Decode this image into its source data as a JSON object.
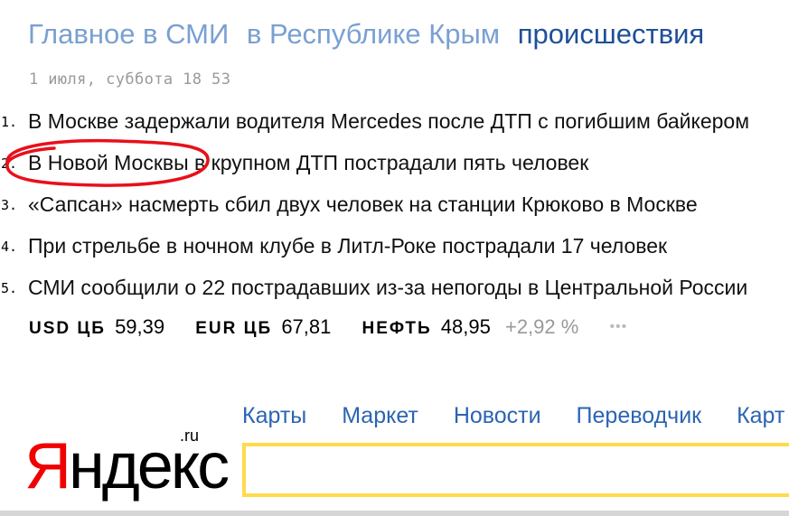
{
  "header": {
    "tabs": [
      {
        "label": "Главное в СМИ",
        "active": false
      },
      {
        "label": "в Республике Крым",
        "active": false
      },
      {
        "label": "происшествия",
        "active": true
      }
    ],
    "date": "1 июля, суббота 18 53"
  },
  "news": [
    {
      "num": "1.",
      "title": "В Москве задержали водителя Mercedes после ДТП с погибшим байкером"
    },
    {
      "num": "2.",
      "title": "В Новой Москвы в крупном ДТП пострадали пять человек"
    },
    {
      "num": "3.",
      "title": "«Сапсан» насмерть сбил двух человек на станции Крюково в Москве"
    },
    {
      "num": "4.",
      "title": "При стрельбе в ночном клубе в Литл-Роке пострадали 17 человек"
    },
    {
      "num": "5.",
      "title": "СМИ сообщили о 22 пострадавших из-за непогоды в Центральной России"
    }
  ],
  "stocks": {
    "usd": {
      "label": "USD ЦБ",
      "value": "59,39"
    },
    "eur": {
      "label": "EUR ЦБ",
      "value": "67,81"
    },
    "oil": {
      "label": "НЕФТЬ",
      "value": "48,95",
      "change": "+2,92 %"
    },
    "more": "•••"
  },
  "services": [
    "Карты",
    "Маркет",
    "Новости",
    "Переводчик",
    "Карт"
  ],
  "logo": {
    "letter1": "Я",
    "rest": "ндекс",
    "suffix": ".ru"
  },
  "search": {
    "placeholder": ""
  },
  "colors": {
    "tab_inactive": "#7aa0d2",
    "tab_active": "#1f4f98",
    "service_link": "#2b64b2",
    "logo_red": "#f00000",
    "search_border": "#ffdb4d",
    "annotation": "#e8101a"
  }
}
